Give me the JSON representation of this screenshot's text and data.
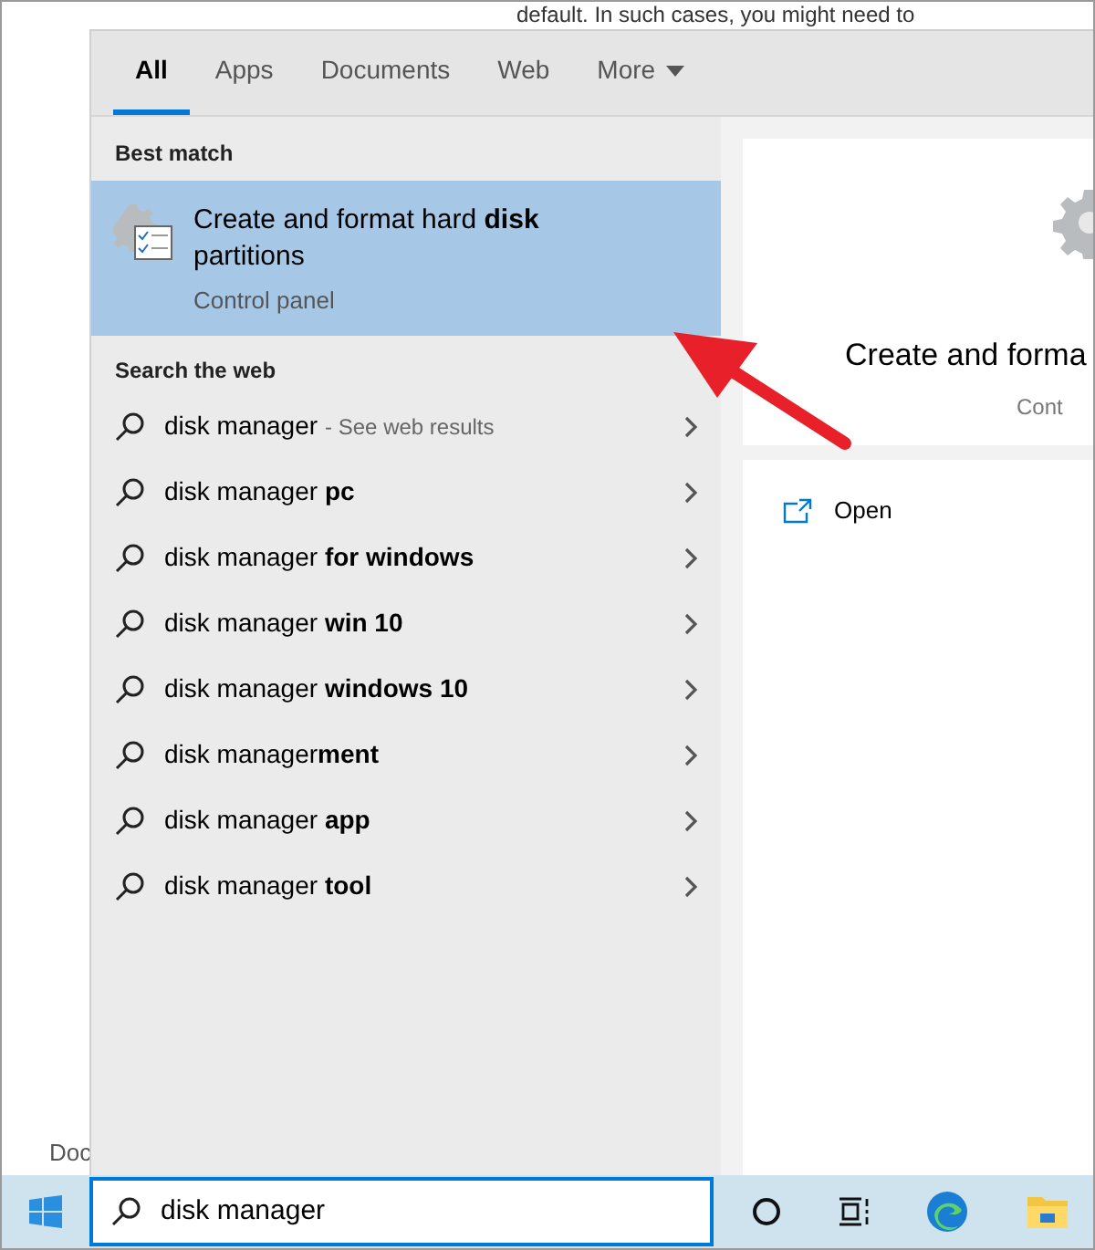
{
  "background_document": {
    "top_line": "default. In such cases, you might need to",
    "bottom_fragment": "Doc"
  },
  "tabs": [
    {
      "label": "All",
      "selected": true,
      "kind": "tab"
    },
    {
      "label": "Apps",
      "selected": false,
      "kind": "tab"
    },
    {
      "label": "Documents",
      "selected": false,
      "kind": "tab"
    },
    {
      "label": "Web",
      "selected": false,
      "kind": "tab"
    },
    {
      "label": "More",
      "selected": false,
      "kind": "dropdown"
    }
  ],
  "best_match": {
    "heading": "Best match",
    "title": "Create and format hard **disk** partitions",
    "subtitle": "Control panel",
    "selected": true
  },
  "search_the_web": {
    "heading": "Search the web",
    "items": [
      {
        "text": "disk manager",
        "suffix": "- See web results"
      },
      {
        "text": "disk manager **pc**"
      },
      {
        "text": "disk manager **for windows**"
      },
      {
        "text": "disk manager **win 10**"
      },
      {
        "text": "disk manager **windows 10**"
      },
      {
        "text": "disk manager**ment**"
      },
      {
        "text": "disk manager **app**"
      },
      {
        "text": "disk manager **tool**"
      }
    ]
  },
  "preview": {
    "title": "Create and forma",
    "subtitle": "Cont",
    "actions": [
      {
        "label": "Open"
      }
    ]
  },
  "taskbar": {
    "search": {
      "value": "disk manager"
    }
  }
}
